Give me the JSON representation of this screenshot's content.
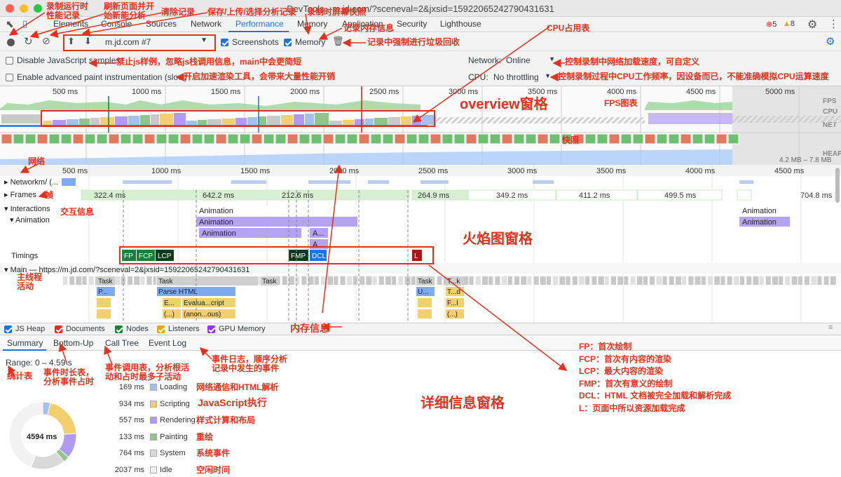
{
  "window": {
    "title": "DevTools - m.jd.com/?sceneval=2&jxsid=15922065242790431631"
  },
  "tabs": [
    "Elements",
    "Console",
    "Sources",
    "Network",
    "Performance",
    "Memory",
    "Application",
    "Security",
    "Lighthouse"
  ],
  "status": {
    "errors": "5",
    "warnings": "8"
  },
  "toolbar": {
    "profile": "m.jd.com #7",
    "screenshots": "Screenshots",
    "memory": "Memory"
  },
  "settings": {
    "disable_js_samples": "Disable JavaScript samples",
    "advanced_paint": "Enable advanced paint instrumentation (slow)",
    "network_label": "Network:",
    "network_value": "Online",
    "cpu_label": "CPU:",
    "cpu_value": "No throttling"
  },
  "overview": {
    "ticks": [
      "500 ms",
      "1000 ms",
      "1500 ms",
      "2000 ms",
      "2500 ms",
      "3000 ms",
      "3500 ms",
      "4000 ms",
      "4500 ms",
      "5000 ms"
    ],
    "lanes": [
      "FPS",
      "CPU",
      "NET",
      "HEAP"
    ],
    "heap_range": "4.2 MB – 7.8 MB"
  },
  "flame": {
    "ticks": [
      "500 ms",
      "1000 ms",
      "1500 ms",
      "2000 ms",
      "2500 ms",
      "3000 ms",
      "3500 ms",
      "4000 ms",
      "4500 ms"
    ],
    "network_label": "Network",
    "network_suffix": "m/ (...",
    "frames_label": "Frames",
    "frame_times": [
      "322.4 ms",
      "642.2 ms",
      "212.6 ms",
      "264.9 ms",
      "349.2 ms",
      "411.2 ms",
      "499.5 ms",
      "704.8 ms"
    ],
    "interactions_label": "Interactions",
    "animation_label": "Animation",
    "anim_bars": [
      "Animation",
      "Animation",
      "Animation",
      "A...",
      "A...",
      "Animation",
      "Animation"
    ],
    "timings_label": "Timings",
    "timings": [
      "FP",
      "FCP",
      "LCP",
      "FMP",
      "DCL",
      "L"
    ],
    "main_label": "Main — https://m.jd.com/?sceneval=2&jxsid=15922065242790431631",
    "tasks": [
      "Task",
      "Task",
      "Task",
      "Task",
      "Task",
      "T...k",
      "P...",
      "Parse HTML",
      "U...",
      "T...d",
      "E...",
      "Evalua...cript",
      "F...l",
      "(...)",
      "(anon...ous)",
      "(...)"
    ]
  },
  "memory_bar": {
    "items": [
      "JS Heap",
      "Documents",
      "Nodes",
      "Listeners",
      "GPU Memory"
    ],
    "colors": [
      "#1a73e8",
      "#d93025",
      "#188038",
      "#e8a600",
      "#9334e6"
    ]
  },
  "bottom_tabs": [
    "Summary",
    "Bottom-Up",
    "Call Tree",
    "Event Log"
  ],
  "summary": {
    "range": "Range: 0 – 4.59 s",
    "total": "4594 ms",
    "rows": [
      {
        "ms": "169 ms",
        "name": "Loading",
        "color": "#a4c1ea",
        "note": "网络通信和HTML解析"
      },
      {
        "ms": "934 ms",
        "name": "Scripting",
        "color": "#f2cf6f",
        "note": "JavaScript执行"
      },
      {
        "ms": "557 ms",
        "name": "Rendering",
        "color": "#af9bf2",
        "note": "样式计算和布局"
      },
      {
        "ms": "133 ms",
        "name": "Painting",
        "color": "#90c489",
        "note": "重绘"
      },
      {
        "ms": "764 ms",
        "name": "System",
        "color": "#d9d9d9",
        "note": "系统事件"
      },
      {
        "ms": "2037 ms",
        "name": "Idle",
        "color": "#f2f2f2",
        "note": "空闲时间"
      }
    ]
  },
  "annotations": {
    "record": "录制运行时\n性能记录",
    "reload": "刷新页面并开\n始新能分析",
    "clear": "清除记录",
    "save": "保存/上传/选择分析记录",
    "screenshot": "录制时屏幕快照",
    "memory": "记录内存信息",
    "gc": "记录中强制进行垃圾回收",
    "cpu_usage": "CPU占用表",
    "disable_js": "禁止js样例，忽略js栈调用信息，main中会更简短",
    "paint": "开启加速渲染工具，会带来大量性能开销",
    "network_throttle": "控制录制中网络加载速度，可自定义",
    "cpu_throttle": "控制录制过程中CPU工作频率，因设备而已，不能准确模拟CPU运算速度",
    "overview": "overview窗格",
    "fps": "FPS图表",
    "snapshot": "快照",
    "network": "网络",
    "frame": "帧",
    "interaction": "交互信息",
    "flame": "火焰图窗格",
    "main": "主线程\n活动",
    "memory_info": "内存信息",
    "summary": "统计表",
    "bottom_up": "事件时长表，\n分析事件占时",
    "call_tree": "事件调用表，分析根活\n动和占时最多子活动",
    "event_log": "事件日志，顺序分析\n记录中发生的事件",
    "details": "详细信息窗格",
    "metrics": [
      "FP：首次绘制",
      "FCP：首次有内容的渲染",
      "LCP：最大内容的渲染",
      "FMP：首次有意义的绘制",
      "DCL：HTML 文档被完全加载和解析完成",
      "L：页面中所以资源加载完成"
    ]
  }
}
